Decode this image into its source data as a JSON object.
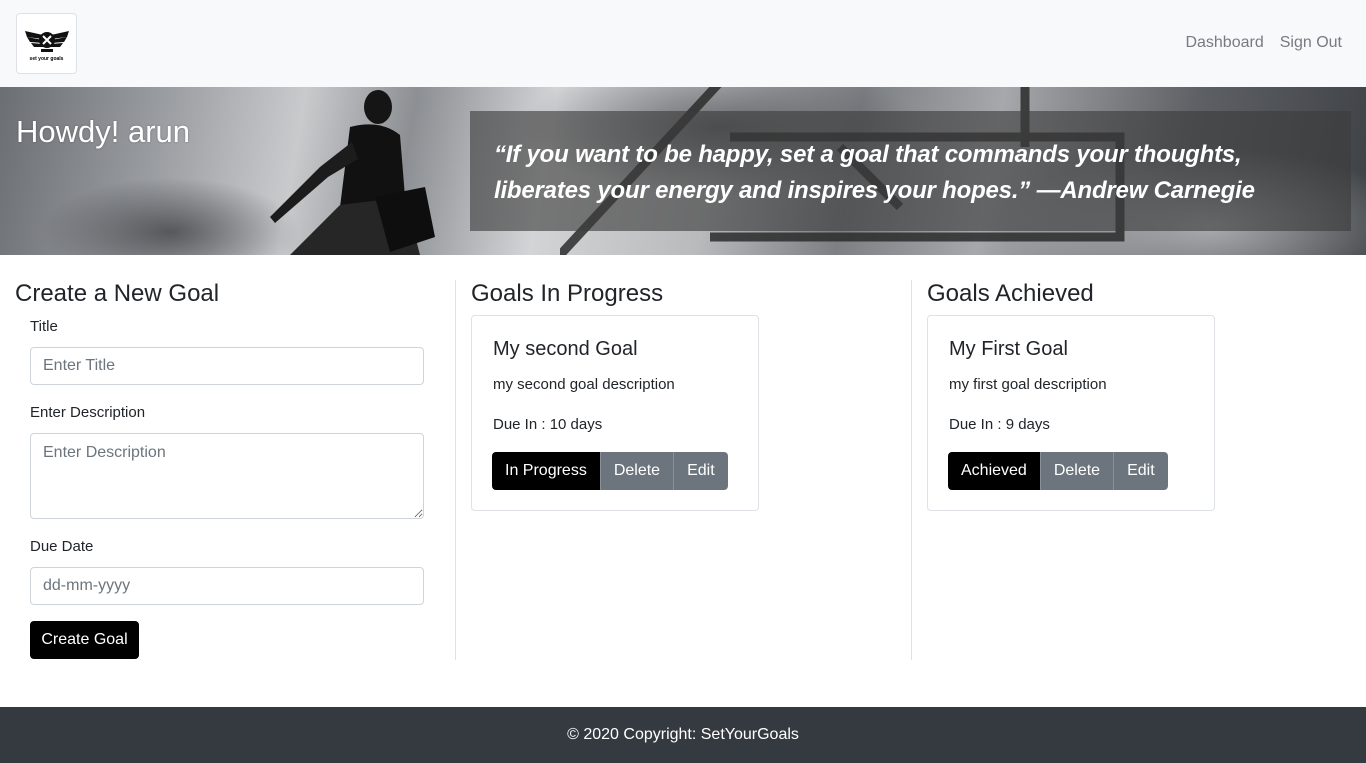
{
  "navbar": {
    "logo_text": "set your goals",
    "links": [
      {
        "label": "Dashboard"
      },
      {
        "label": "Sign Out"
      }
    ]
  },
  "hero": {
    "greeting": "Howdy! arun",
    "quote": "“If you want to be happy, set a goal that commands your thoughts, liberates your energy and inspires your hopes.” —Andrew Carnegie"
  },
  "create_goal": {
    "heading": "Create a New Goal",
    "title_label": "Title",
    "title_placeholder": "Enter Title",
    "title_value": "",
    "description_label": "Enter Description",
    "description_placeholder": "Enter Description",
    "description_value": "",
    "due_date_label": "Due Date",
    "due_date_placeholder": "dd-mm-yyyy",
    "due_date_value": "",
    "submit_label": "Create Goal"
  },
  "in_progress": {
    "heading": "Goals In Progress",
    "goals": [
      {
        "title": "My second Goal",
        "description": "my second goal description",
        "due": "Due In : 10 days",
        "status_label": "In Progress",
        "delete_label": "Delete",
        "edit_label": "Edit"
      }
    ]
  },
  "achieved": {
    "heading": "Goals Achieved",
    "goals": [
      {
        "title": "My First Goal",
        "description": "my first goal description",
        "due": "Due In : 9 days",
        "status_label": "Achieved",
        "delete_label": "Delete",
        "edit_label": "Edit"
      }
    ]
  },
  "footer": {
    "copyright": "© 2020 Copyright: SetYourGoals"
  },
  "colors": {
    "navbar_bg": "#f8f9fa",
    "primary_button": "#000000",
    "secondary_button": "#6c757d",
    "footer_bg": "#343a40"
  }
}
